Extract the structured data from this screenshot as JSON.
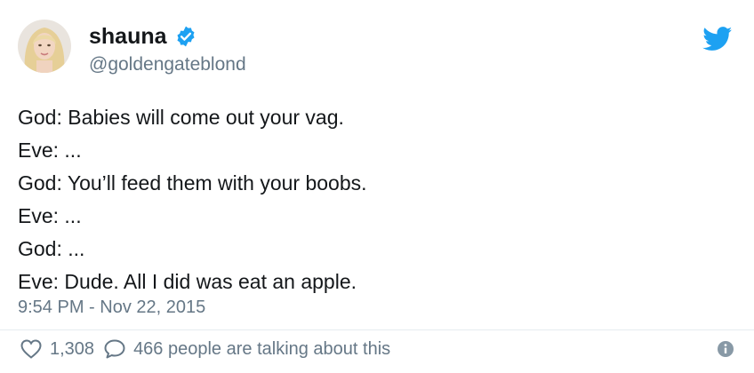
{
  "user": {
    "display_name": "shauna",
    "handle": "@goldengateblond",
    "verified": true
  },
  "icons": {
    "avatar": "user-avatar",
    "verified": "verified-badge-icon",
    "brand": "twitter-bird-icon",
    "like": "heart-icon",
    "reply": "comment-bubble-icon",
    "info": "info-icon"
  },
  "colors": {
    "brand_blue": "#1da1f2",
    "text_primary": "#14171a",
    "text_secondary": "#657786"
  },
  "tweet": {
    "lines": [
      "God: Babies will come out your vag.",
      "Eve: ...",
      "God: You’ll feed them with your boobs.",
      "Eve: ...",
      "God: ...",
      "Eve: Dude. All I did was eat an apple."
    ],
    "timestamp": "9:54 PM - Nov 22, 2015"
  },
  "engagement": {
    "likes": "1,308",
    "talking": "466 people are talking about this"
  }
}
